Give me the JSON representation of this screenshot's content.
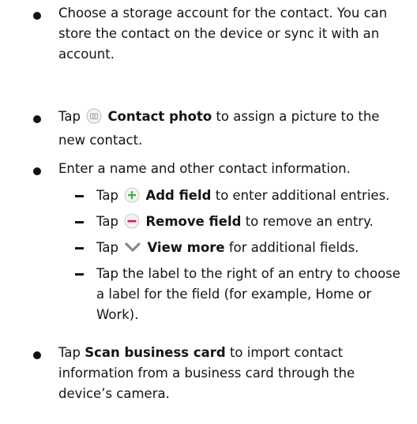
{
  "bullets": [
    {
      "text": "Choose a storage account for the contact. You can store the contact on the device or sync it with an account."
    },
    {
      "pre": "Tap",
      "icon": "camera-circle-icon",
      "bold": "Contact photo",
      "post": "to assign a picture to the new contact."
    },
    {
      "text": "Enter a name and other contact information."
    },
    {
      "pre": "Tap",
      "bold": "Scan business card",
      "post": "to import contact information from a business card through the device’s camera."
    }
  ],
  "subitems": [
    {
      "pre": "Tap",
      "icon": "plus-circle-icon",
      "bold": "Add field",
      "post": "to enter additional entries."
    },
    {
      "pre": "Tap",
      "icon": "minus-circle-icon",
      "bold": "Remove field",
      "post": "to remove an entry."
    },
    {
      "pre": "Tap",
      "icon": "chevron-down-icon",
      "bold": "View more",
      "post": "for additional fields."
    },
    {
      "text": "Tap the label to the right of an entry to choose a label for the field (for example, Home or Work)."
    }
  ],
  "colors": {
    "plus_icon": "#3db53d",
    "minus_icon": "#d9184a",
    "chevron_icon": "#888888",
    "camera_icon": "#aaaaaa"
  }
}
